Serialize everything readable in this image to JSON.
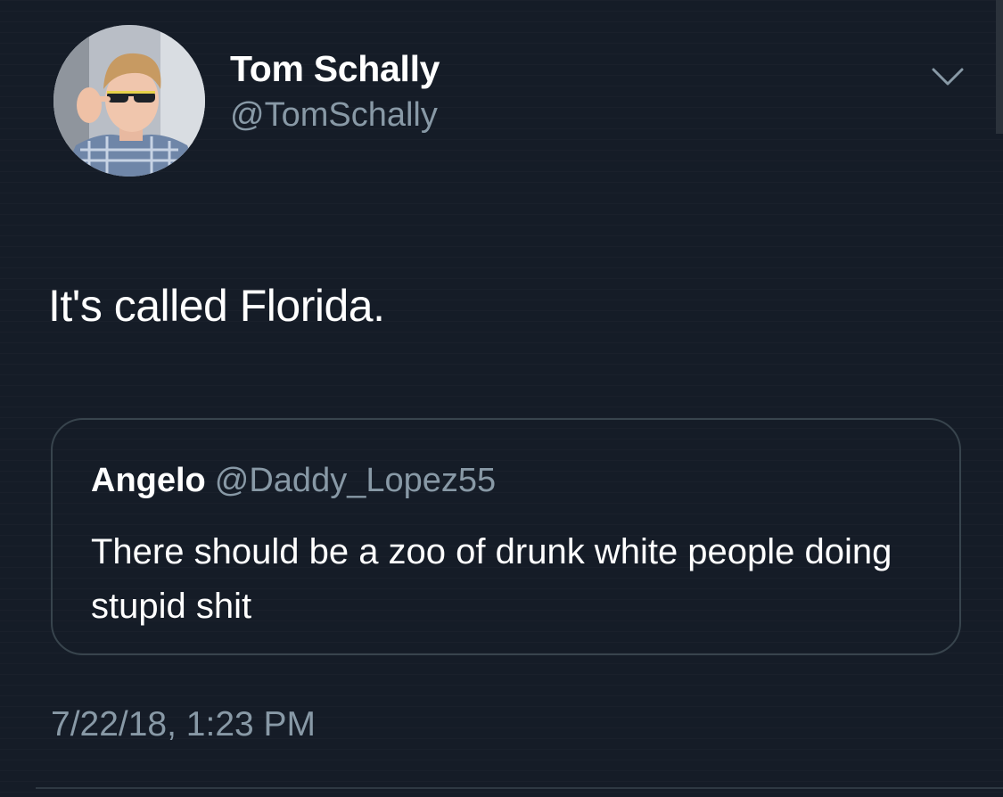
{
  "tweet": {
    "author": {
      "display_name": "Tom Schally",
      "handle": "@TomSchally"
    },
    "text": "It's called Florida.",
    "quoted_tweet": {
      "display_name": "Angelo",
      "handle": "@Daddy_Lopez55",
      "text": "There should be a zoo of drunk white people doing stupid shit"
    },
    "timestamp": "7/22/18, 1:23 PM"
  },
  "icons": {
    "menu": "chevron-down-icon",
    "avatar": "profile-photo"
  },
  "colors": {
    "background": "#151c27",
    "primary_text": "#ffffff",
    "secondary_text": "#8899a6",
    "border": "#38444d"
  }
}
